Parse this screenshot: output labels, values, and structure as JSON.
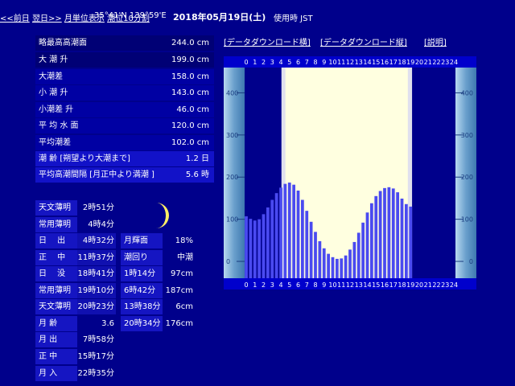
{
  "header": {
    "coords": "35°41'N 139°59'E",
    "date": "2018年05月19日(土)",
    "timezone": "使用時 JST",
    "prev": "<<前日",
    "next": "翌日>>",
    "monthly": "月単位表示",
    "interval": "潮位10分割"
  },
  "links": {
    "download_h": "[データダウンロード横]",
    "download_v": "[データダウンロード縦]",
    "explain": "[説明]"
  },
  "tide_info": [
    {
      "label": "略最高高潮面",
      "value": "244.0 cm"
    },
    {
      "label": "大 潮 升",
      "value": "199.0 cm"
    },
    {
      "label": "大潮差",
      "value": "158.0 cm"
    },
    {
      "label": "小 潮 升",
      "value": "143.0 cm"
    },
    {
      "label": "小潮差 升",
      "value": "46.0 cm"
    },
    {
      "label": "平 均 水 面",
      "value": "120.0 cm"
    },
    {
      "label": "平均潮差",
      "value": "102.0 cm"
    },
    {
      "label": "潮 齢 [朔望より大潮まで]",
      "value": "1.2 日"
    },
    {
      "label": "平均高潮間隔 [月正中より満潮 ]",
      "value": "5.6 時"
    }
  ],
  "sun_moon": [
    {
      "label": "天文薄明",
      "value": "2時51分"
    },
    {
      "label": "常用薄明",
      "value": "4時4分"
    },
    {
      "label": "日　 出",
      "value": "4時32分"
    },
    {
      "label": "正　 中",
      "value": "11時37分"
    },
    {
      "label": "日　 没",
      "value": "18時41分"
    },
    {
      "label": "常用薄明",
      "value": "19時10分"
    },
    {
      "label": "天文薄明",
      "value": "20時23分"
    },
    {
      "label": "月 齢",
      "value": "3.6"
    },
    {
      "label": "月 出",
      "value": "7時58分"
    },
    {
      "label": "正 中",
      "value": "15時17分"
    },
    {
      "label": "月 入",
      "value": "22時35分"
    }
  ],
  "moon_info": [
    {
      "label": "月輝面",
      "value": "18%"
    },
    {
      "label": "潮回り",
      "value": "中潮"
    }
  ],
  "tide_times": [
    {
      "time": "1時14分",
      "height": "97cm"
    },
    {
      "time": "6時42分",
      "height": "187cm"
    },
    {
      "time": "13時38分",
      "height": "6cm"
    },
    {
      "time": "20時34分",
      "height": "176cm"
    }
  ],
  "colors": {
    "background": "#00008b",
    "daylight": "#ffffe0",
    "twilight": "#e0e0ee",
    "bars": "#4a4af0",
    "night": "#00008b",
    "scale": "#80b4d8"
  },
  "chart_data": {
    "type": "bar",
    "x_ticks": [
      "0",
      "1",
      "2",
      "3",
      "4",
      "5",
      "6",
      "7",
      "8",
      "9",
      "10",
      "11",
      "12",
      "13",
      "14",
      "15",
      "16",
      "17",
      "18",
      "19",
      "20",
      "21",
      "22",
      "23",
      "24"
    ],
    "y_ticks": [
      "400",
      "300",
      "200",
      "100",
      "0"
    ],
    "ylim": [
      -40,
      460
    ],
    "ylabel": "",
    "xlabel": "",
    "x": [
      0,
      0.5,
      1,
      1.5,
      2,
      2.5,
      3,
      3.5,
      4,
      4.5,
      5,
      5.5,
      6,
      6.5,
      7,
      7.5,
      8,
      8.5,
      9,
      9.5,
      10,
      10.5,
      11,
      11.5,
      12,
      12.5,
      13,
      13.5,
      14,
      14.5,
      15,
      15.5,
      16,
      16.5,
      17,
      17.5,
      18,
      18.5,
      19,
      19.5,
      20,
      20.5,
      21,
      21.5,
      22,
      22.5,
      23,
      23.5,
      24
    ],
    "values": [
      107,
      101,
      97,
      100,
      112,
      128,
      146,
      162,
      175,
      184,
      187,
      182,
      168,
      146,
      120,
      94,
      70,
      48,
      31,
      18,
      10,
      6,
      7,
      14,
      28,
      46,
      68,
      92,
      116,
      138,
      155,
      167,
      174,
      176,
      173,
      164,
      149,
      136,
      130
    ],
    "values_note": "",
    "daylight": {
      "start": 4.53,
      "end": 18.68
    },
    "twilight": {
      "start": 4.07,
      "end": 19.17
    }
  }
}
